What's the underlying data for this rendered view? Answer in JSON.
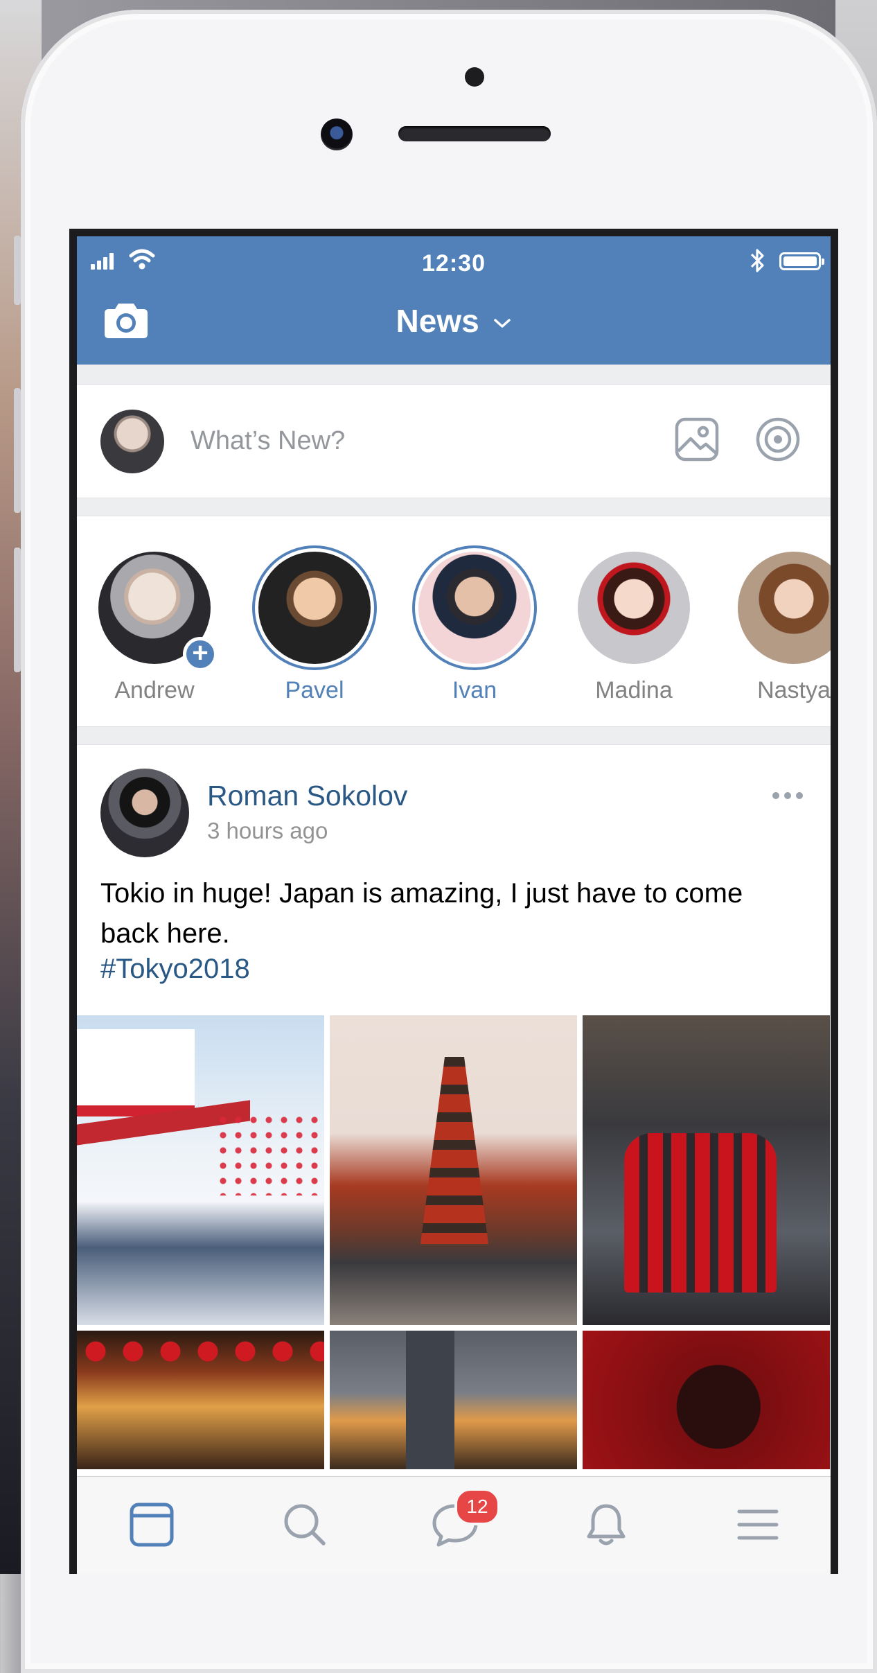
{
  "status_bar": {
    "time": "12:30"
  },
  "header": {
    "title": "News"
  },
  "composer": {
    "placeholder": "What’s New?"
  },
  "stories": [
    {
      "name": "Andrew",
      "active": false
    },
    {
      "name": "Pavel",
      "active": true
    },
    {
      "name": "Ivan",
      "active": true
    },
    {
      "name": "Madina",
      "active": false
    },
    {
      "name": "Nastya",
      "active": false
    }
  ],
  "post": {
    "author": "Roman Sokolov",
    "time": "3 hours ago",
    "text": "Tokio in huge! Japan is amazing, I just have to come back here.",
    "hashtag": "#Tokyo2018"
  },
  "tab_bar": {
    "items": [
      "news",
      "search",
      "messages",
      "notifications",
      "menu"
    ],
    "messages_badge": "12"
  },
  "colors": {
    "brand": "#5181b8",
    "link": "#2a5885",
    "badge": "#e64646"
  }
}
